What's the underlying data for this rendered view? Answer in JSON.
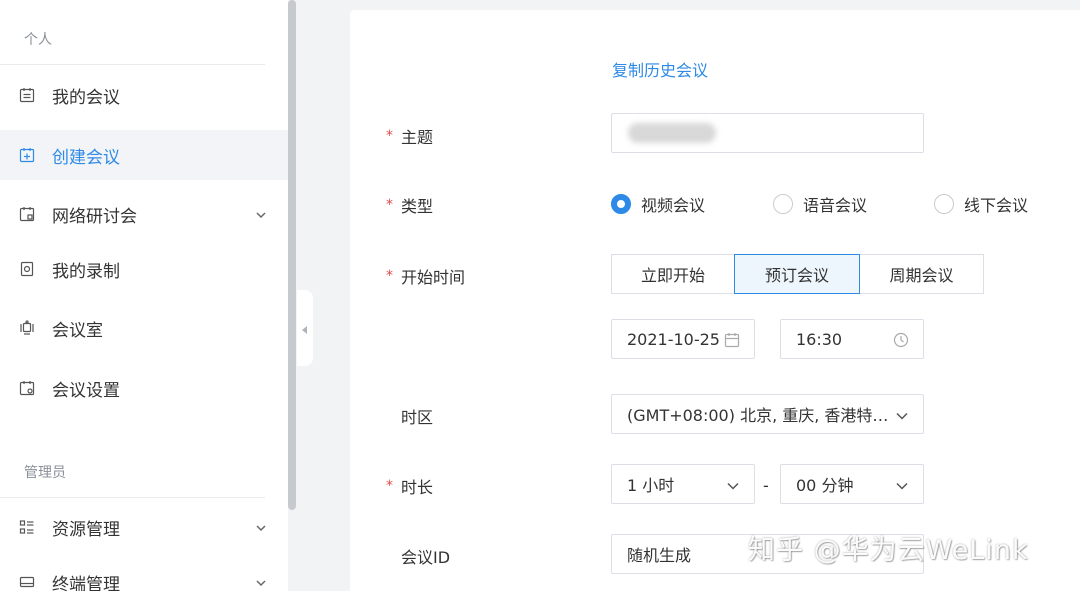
{
  "sidebar": {
    "personal_title": "个人",
    "admin_title": "管理员",
    "items": [
      {
        "label": "我的会议",
        "icon": "calendar-list-icon"
      },
      {
        "label": "创建会议",
        "icon": "calendar-add-icon",
        "active": true
      },
      {
        "label": "网络研讨会",
        "icon": "webinar-calendar-icon",
        "expandable": true
      },
      {
        "label": "我的录制",
        "icon": "recording-icon"
      },
      {
        "label": "会议室",
        "icon": "meeting-room-icon"
      },
      {
        "label": "会议设置",
        "icon": "meeting-settings-icon"
      }
    ],
    "admin_items": [
      {
        "label": "资源管理",
        "icon": "resource-grid-icon",
        "expandable": true
      },
      {
        "label": "终端管理",
        "icon": "terminal-icon",
        "expandable": true
      }
    ]
  },
  "form": {
    "copy_history_link": "复制历史会议",
    "subject_label": "主题",
    "type_label": "类型",
    "type_options": [
      "视频会议",
      "语音会议",
      "线下会议"
    ],
    "type_selected": "视频会议",
    "start_time_label": "开始时间",
    "start_modes": [
      "立即开始",
      "预订会议",
      "周期会议"
    ],
    "start_mode_selected": "预订会议",
    "date_value": "2021-10-25",
    "time_value": "16:30",
    "timezone_label": "时区",
    "timezone_value": "(GMT+08:00) 北京, 重庆, 香港特…",
    "duration_label": "时长",
    "duration_hours": "1 小时",
    "duration_separator": "-",
    "duration_minutes": "00 分钟",
    "meeting_id_label": "会议ID",
    "meeting_id_value": "随机生成"
  },
  "watermark": "知乎 @华为云WeLink",
  "colors": {
    "accent": "#2e8ae6",
    "required": "#e24a4a",
    "active_bg": "#f2f4f7",
    "page_bg": "#f2f3f5"
  }
}
